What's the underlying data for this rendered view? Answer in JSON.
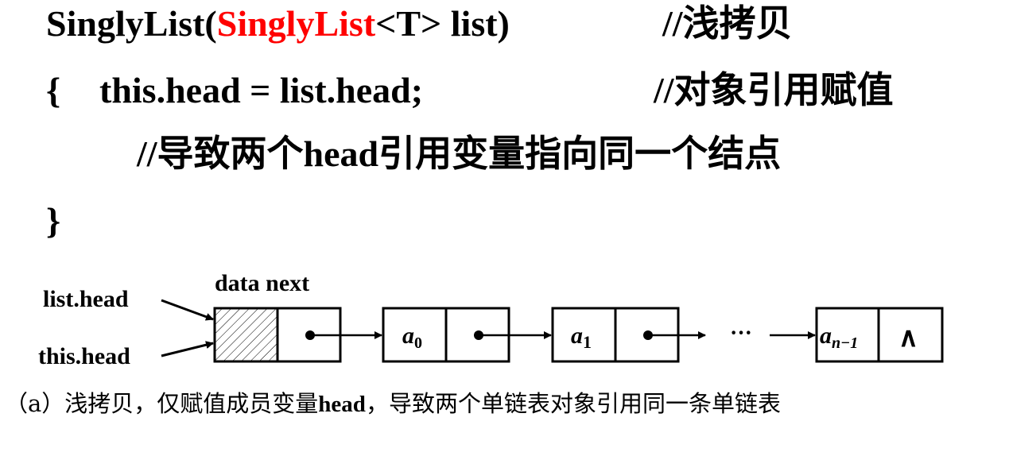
{
  "code": {
    "line1": {
      "prefix": "SinglyList(",
      "param_type": "SinglyList",
      "suffix": "<T> list)",
      "comment": "//浅拷贝"
    },
    "line2": {
      "brace": "{",
      "statement": "this.head = list.head;",
      "comment": "//对象引用赋值"
    },
    "line3": {
      "comment": "//导致两个head引用变量指向同一个结点"
    },
    "line4": {
      "brace": "}"
    },
    "highlight_color": "#ff0000"
  },
  "diagram": {
    "field_labels": "data next",
    "pointers": [
      "list.head",
      "this.head"
    ],
    "nodes": [
      {
        "data": "",
        "hatched": true
      },
      {
        "data": "a",
        "sub": "0"
      },
      {
        "data": "a",
        "sub": "1"
      },
      {
        "data": "a",
        "sub": "n−1",
        "next": "∧"
      }
    ],
    "ellipsis": "···"
  },
  "caption": {
    "prefix": "（a）浅拷贝，仅赋值成员变量",
    "bold": "head",
    "suffix": "，导致两个单链表对象引用同一条单链表"
  }
}
